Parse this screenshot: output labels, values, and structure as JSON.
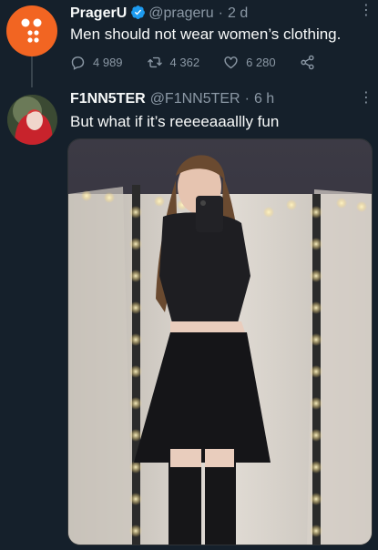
{
  "tweet1": {
    "display_name": "PragerU",
    "handle": "@prageru",
    "separator": "·",
    "time": "2 d",
    "text": "Men should not wear women’s clothing.",
    "avatar_color": "#f26522",
    "stats": {
      "replies": "4 989",
      "retweets": "4 362",
      "likes": "6 280"
    }
  },
  "tweet2": {
    "display_name": "F1NN5TER",
    "handle": "@F1NN5TER",
    "separator": "·",
    "time": "6 h",
    "text": "But what if it’s reeeeaaallly fun"
  },
  "theme": {
    "background": "#15202b",
    "text": "#f7f9f9",
    "muted": "#8b98a5",
    "verified_blue": "#1d9bf0"
  },
  "icons": [
    "verified-badge-icon",
    "more-options-icon",
    "reply-icon",
    "retweet-icon",
    "like-icon",
    "share-icon"
  ]
}
